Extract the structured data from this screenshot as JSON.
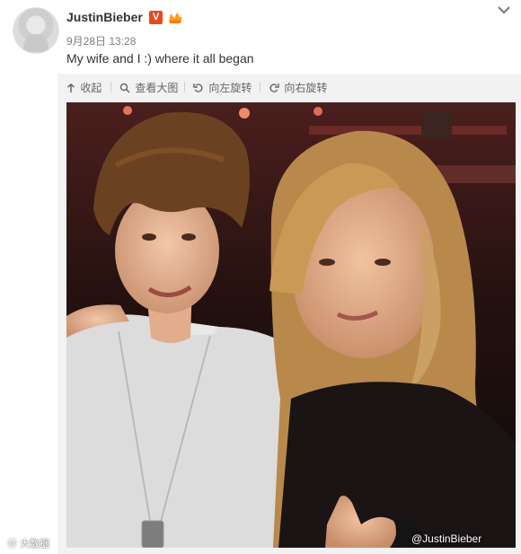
{
  "post": {
    "username": "JustinBieber",
    "verified_badge": "V",
    "time": "9月28日 13:28",
    "text": "My wife and I :) where it all began"
  },
  "toolbar": {
    "collapse_label": "收起",
    "view_large_label": "查看大图",
    "rotate_left_label": "向左旋转",
    "rotate_right_label": "向右旋转"
  },
  "watermarks": {
    "left": "大数据",
    "right": "@JustinBieber"
  },
  "icons": {
    "avatar": "avatar-icon",
    "member": "member-crown-icon",
    "collapse": "chevron-down-icon",
    "collapse_tool": "up-arrow-icon",
    "zoom": "magnifier-icon",
    "rotate_left": "rotate-left-icon",
    "rotate_right": "rotate-right-icon",
    "weibo": "weibo-icon"
  },
  "colors": {
    "accent": "#e74a1e",
    "member": "#ff8a00",
    "muted_text": "#808080"
  }
}
